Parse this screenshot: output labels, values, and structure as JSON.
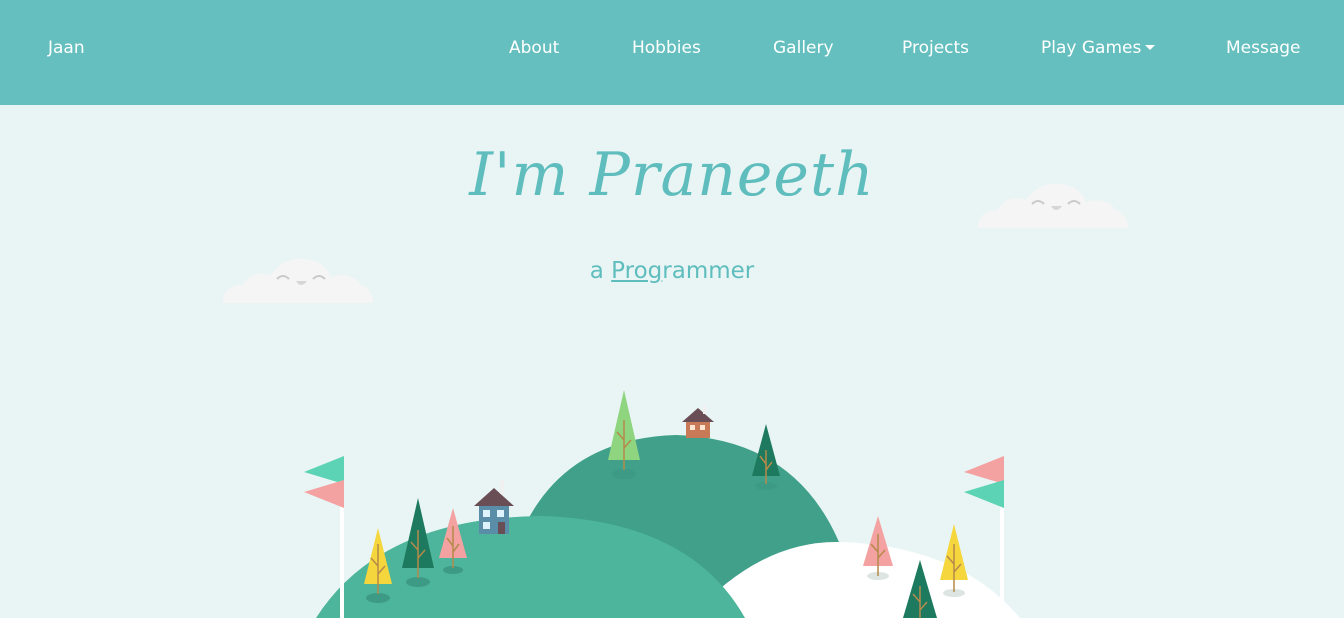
{
  "navbar": {
    "brand": "Jaan",
    "items": [
      {
        "label": "About"
      },
      {
        "label": "Hobbies"
      },
      {
        "label": "Gallery"
      },
      {
        "label": "Projects"
      },
      {
        "label": "Play Games",
        "dropdown": true
      },
      {
        "label": "Message"
      }
    ]
  },
  "hero": {
    "title": "I'm Praneeth",
    "subtitle_prefix": "a",
    "subtitle_typed": "Prog",
    "subtitle_rest": "rammer"
  },
  "colors": {
    "nav_bg": "#66bfbf",
    "page_bg": "#e8f5f4",
    "accent": "#5fbdbd",
    "hill_dark": "#40a08a",
    "hill_light": "#4db59b",
    "tree_yellow": "#f5d63d",
    "tree_pink": "#f4a1a1",
    "tree_green": "#1e7a5e"
  },
  "icons": {
    "caret": "caret-down-icon"
  }
}
